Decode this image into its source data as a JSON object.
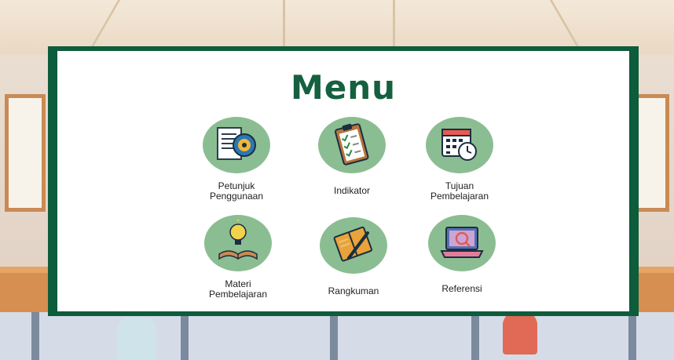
{
  "menu": {
    "title": "Menu",
    "items": [
      {
        "label": "Petunjuk\nPenggunaan",
        "icon": "manual-gear-icon"
      },
      {
        "label": "Indikator",
        "icon": "clipboard-checklist-icon"
      },
      {
        "label": "Tujuan\nPembelajaran",
        "icon": "calendar-clock-icon"
      },
      {
        "label": "Materi\nPembelajaran",
        "icon": "lightbulb-book-icon"
      },
      {
        "label": "Rangkuman",
        "icon": "notebook-pen-icon"
      },
      {
        "label": "Referensi",
        "icon": "laptop-search-icon"
      }
    ]
  },
  "colors": {
    "board": "#0d5c3b",
    "title": "#16603f",
    "icon_circle": "#8bbd92"
  }
}
